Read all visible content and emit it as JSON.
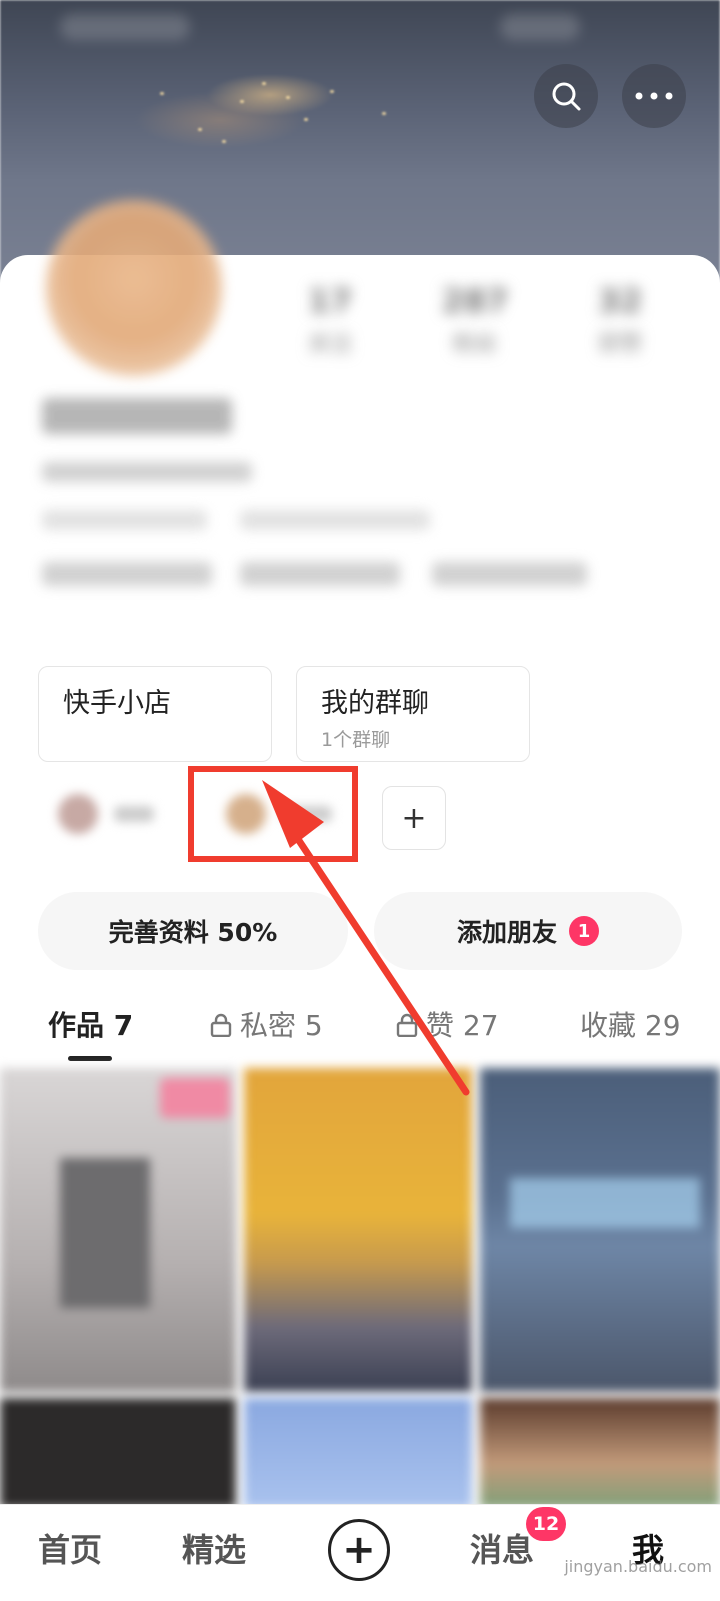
{
  "profile": {
    "stats": [
      {
        "value": "17",
        "label": "关注"
      },
      {
        "value": "287",
        "label": "粉丝"
      },
      {
        "value": "32",
        "label": "获赞"
      }
    ]
  },
  "shortcuts": {
    "shop": {
      "title": "快手小店"
    },
    "group_chat": {
      "title": "我的群聊",
      "subtitle": "1个群聊"
    },
    "add_label": "+"
  },
  "actions": {
    "complete_profile": "完善资料 50%",
    "add_friend": "添加朋友",
    "add_friend_badge": "1"
  },
  "tabs": [
    {
      "label": "作品 7"
    },
    {
      "label": "私密 5"
    },
    {
      "label": "赞 27"
    },
    {
      "label": "收藏 29"
    }
  ],
  "bottom_nav": {
    "home": "首页",
    "featured": "精选",
    "publish": "+",
    "messages": "消息",
    "messages_badge": "12",
    "me": "我"
  },
  "watermark": "jingyan.baidu.com",
  "colors": {
    "accent_badge": "#fe3666",
    "annotation_red": "#f03c2e"
  }
}
